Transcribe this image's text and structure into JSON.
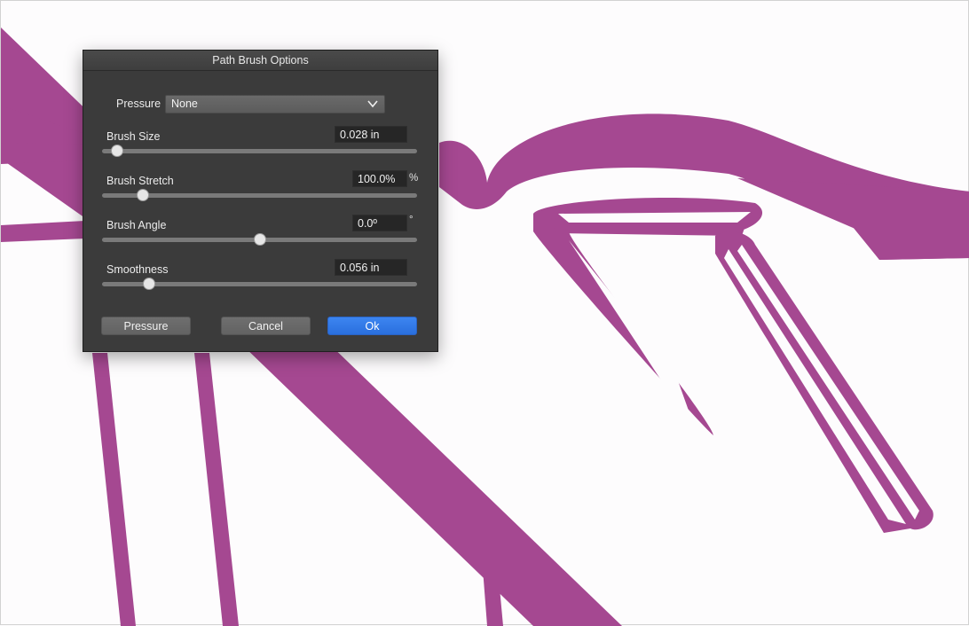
{
  "dialog": {
    "title": "Path Brush Options",
    "pressure": {
      "label": "Pressure",
      "value": "None"
    },
    "sliders": [
      {
        "label": "Brush Size",
        "value": "0.028 in",
        "unit": "",
        "level": 0.03
      },
      {
        "label": "Brush Stretch",
        "value": "100.0%",
        "unit": "%",
        "level": 0.115
      },
      {
        "label": "Brush Angle",
        "value": "0.0º",
        "unit": "°",
        "level": 0.5
      },
      {
        "label": "Smoothness",
        "value": "0.056 in",
        "unit": "",
        "level": 0.135
      }
    ],
    "buttons": {
      "pressure": "Pressure",
      "cancel": "Cancel",
      "ok": "Ok"
    }
  },
  "colors": {
    "stroke": "#a54891",
    "panel": "#3b3b3b",
    "accent": "#2f78e8"
  },
  "icons": {
    "dropdown": "chevron-down-icon"
  }
}
